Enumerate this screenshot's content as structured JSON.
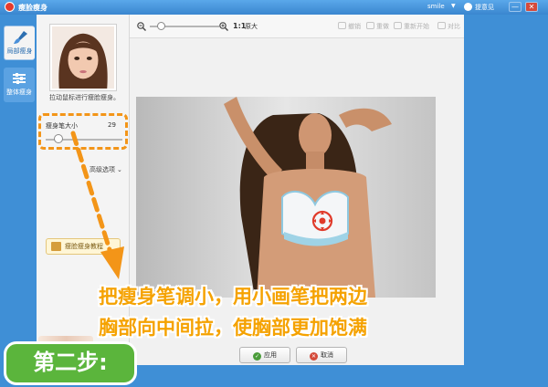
{
  "window": {
    "title": "瘦脸瘦身",
    "user": "smile",
    "help": "提意见",
    "minimize_glyph": "—",
    "close_glyph": "✕"
  },
  "tabs": [
    {
      "label": "局部瘦身",
      "icon": "brush-icon",
      "active": true
    },
    {
      "label": "整体瘦身",
      "icon": "sliders-icon",
      "active": false
    }
  ],
  "panel": {
    "hint": "拉动鼠标进行瘦脸瘦身。",
    "brush_size_label": "瘦身笔大小",
    "brush_size_value": "29",
    "brush_size_fraction": 0.17,
    "advanced_label": "高级选项",
    "tutorial_label": "瘦脸瘦身教程"
  },
  "toolbar": {
    "ratio_label": "1:1",
    "original_label": "原大",
    "undo_label": "撤销",
    "redo_label": "重做",
    "restart_label": "重新开始",
    "compare_label": "对比"
  },
  "footer": {
    "apply_label": "应用",
    "cancel_label": "取消"
  },
  "annotation": {
    "caption_line1": "把瘦身笔调小，用小画笔把两边",
    "caption_line2": "胸部向中间拉，使胸部更加饱满",
    "step_label": "第二步:",
    "accent_color": "#f39518",
    "step_color": "#5bb53c"
  },
  "colors": {
    "chrome_blue": "#3f8fd6",
    "panel_bg": "#f4f4f4"
  }
}
